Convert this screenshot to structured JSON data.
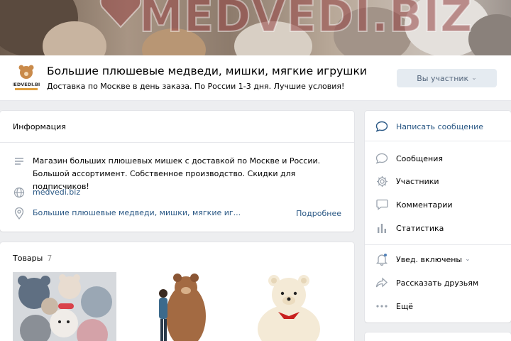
{
  "cover": {
    "logo_text": "MEDVEDI.BIZ"
  },
  "header": {
    "avatar_text": "MEDVEDI.BIZ",
    "title": "Большие плюшевые медведи, мишки, мягкие игрушки",
    "status": "Доставка по Москве в день заказа. По России 1-3 дня. Лучшие условия!",
    "member_button": "Вы участник"
  },
  "info": {
    "title": "Информация",
    "description": "Магазин больших плюшевых мишек с доставкой по Москве и России. Большой ассортимент. Собственное производство. Скидки для подписчиков!",
    "website": "medvedi.biz",
    "address": "Большие плюшевые медведи, мишки, мягкие иг...",
    "more": "Подробнее"
  },
  "goods": {
    "title": "Товары",
    "count": "7"
  },
  "sidebar": {
    "write_message": "Написать сообщение",
    "items": [
      {
        "label": "Сообщения",
        "icon": "message-icon"
      },
      {
        "label": "Участники",
        "icon": "gear-icon"
      },
      {
        "label": "Комментарии",
        "icon": "comment-icon"
      },
      {
        "label": "Статистика",
        "icon": "stats-icon"
      }
    ],
    "notifications": "Увед. включены",
    "share": "Рассказать друзьям",
    "more": "Ещё"
  },
  "colors": {
    "link": "#2a5885",
    "button_bg": "#e5ebf1",
    "page_bg": "#edeef0"
  }
}
